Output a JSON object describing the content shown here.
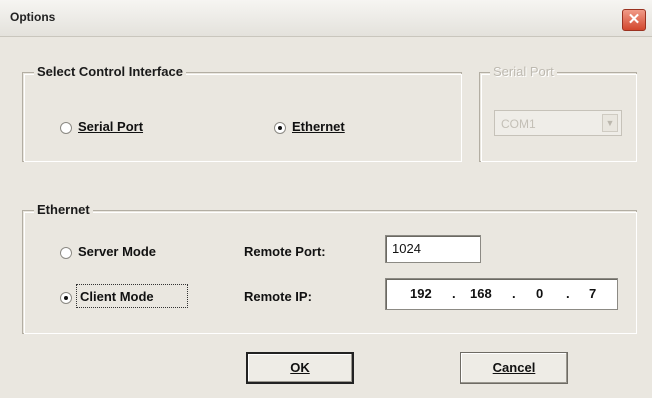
{
  "window": {
    "title": "Options",
    "close_glyph": "✕"
  },
  "control_group": {
    "legend": "Select Control Interface",
    "options": [
      {
        "label": "Serial Port",
        "selected": false
      },
      {
        "label": "Ethernet",
        "selected": true
      }
    ]
  },
  "serial_group": {
    "legend": "Serial Port",
    "port_value": "COM1",
    "arrow_glyph": "▼",
    "enabled": false
  },
  "ethernet_group": {
    "legend": "Ethernet",
    "modes": [
      {
        "label": "Server Mode",
        "selected": false
      },
      {
        "label": "Client Mode",
        "selected": true
      }
    ],
    "remote_port_label": "Remote Port:",
    "remote_port_value": "1024",
    "remote_ip_label": "Remote IP:",
    "ip_octets": [
      "192",
      "168",
      "0",
      "7"
    ],
    "ip_dot": "."
  },
  "buttons": {
    "ok": "OK",
    "cancel": "Cancel"
  }
}
